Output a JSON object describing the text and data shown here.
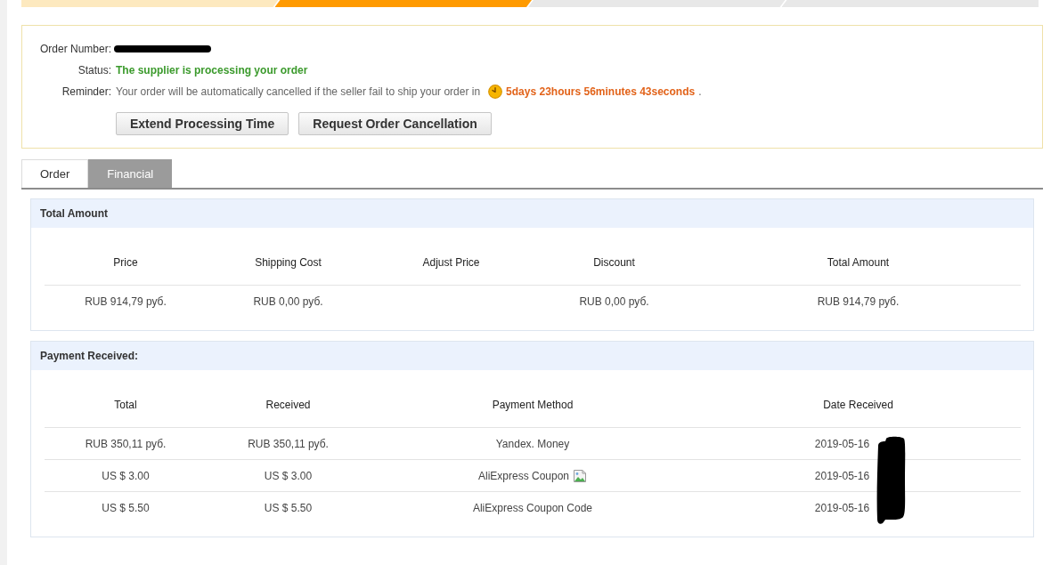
{
  "progress_steps": [
    {
      "completed": true,
      "current": false
    },
    {
      "completed": true,
      "current": true
    },
    {
      "completed": false,
      "current": false
    },
    {
      "completed": false,
      "current": false
    }
  ],
  "order_info": {
    "rows": [
      {
        "label": "Order Number:",
        "kind": "redacted"
      },
      {
        "label": "Status:",
        "kind": "status",
        "value": "The supplier is processing your order"
      },
      {
        "label": "Reminder:",
        "kind": "reminder",
        "value": "Your order will be automatically cancelled if the seller fail to ship your order in",
        "countdown": "5days 23hours 56minutes 43seconds",
        "end": "."
      }
    ],
    "buttons": [
      "Extend Processing Time",
      "Request Order Cancellation"
    ]
  },
  "tabs": [
    {
      "label": "Order",
      "selected": false
    },
    {
      "label": "Financial",
      "selected": true
    }
  ],
  "total_amount": {
    "title": "Total Amount",
    "columns": [
      "Price",
      "Shipping Cost",
      "Adjust Price",
      "Discount",
      "Total Amount"
    ],
    "rows": [
      {
        "cells": [
          "RUB 914,79 руб.",
          "RUB 0,00 руб.",
          null,
          "RUB 0,00 руб.",
          "RUB 914,79 руб."
        ]
      }
    ]
  },
  "payment_received": {
    "title": "Payment Received:",
    "columns": [
      "Total",
      "Received",
      "Payment Method",
      "Date Received"
    ],
    "rows": [
      {
        "cells": [
          "RUB 350,11 руб.",
          "RUB 350,11 руб.",
          "Yandex. Money",
          "2019-05-16"
        ],
        "image_icon": false
      },
      {
        "cells": [
          "US $ 3.00",
          "US $ 3.00",
          "AliExpress Coupon",
          "2019-05-16"
        ],
        "image_icon": true
      },
      {
        "cells": [
          "US $ 5.50",
          "US $ 5.50",
          "AliExpress Coupon Code",
          "2019-05-16"
        ],
        "image_icon": false
      }
    ]
  }
}
